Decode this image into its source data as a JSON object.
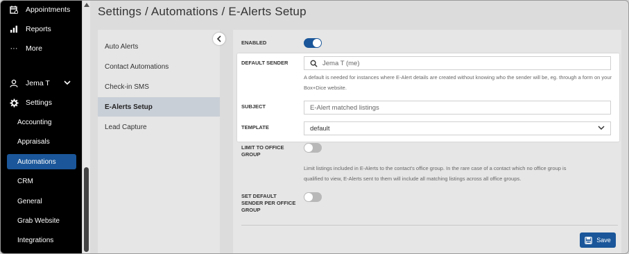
{
  "nav": {
    "items": [
      {
        "label": "Appointments",
        "icon": "calendar-icon"
      },
      {
        "label": "Reports",
        "icon": "bar-chart-icon"
      },
      {
        "label": "More",
        "icon": "ellipsis-icon"
      }
    ],
    "user": {
      "label": "Jema T",
      "icon": "user-icon"
    },
    "settings": {
      "label": "Settings",
      "icon": "gear-icon"
    },
    "sub_items": [
      "Accounting",
      "Appraisals",
      "Automations",
      "CRM",
      "General",
      "Grab Website",
      "Integrations"
    ],
    "active_sub": "Automations"
  },
  "header": {
    "title": "Settings / Automations / E-Alerts Setup"
  },
  "submenu": {
    "items": [
      "Auto Alerts",
      "Contact Automations",
      "Check-in SMS",
      "E-Alerts Setup",
      "Lead Capture"
    ],
    "active": "E-Alerts Setup"
  },
  "form": {
    "enabled": {
      "label": "ENABLED",
      "value": true
    },
    "default_sender": {
      "label": "DEFAULT SENDER",
      "value": "Jema T (me)",
      "help": "A default is needed for instances where E-Alert details are created without knowing who the sender will be, eg. through a form on your Box+Dice website."
    },
    "subject": {
      "label": "SUBJECT",
      "value": "E-Alert matched listings"
    },
    "template": {
      "label": "TEMPLATE",
      "value": "default"
    },
    "limit_to_office_group": {
      "label_line1": "LIMIT TO OFFICE",
      "label_line2": "GROUP",
      "value": false,
      "help_line1": "Limit listings included in E-Alerts to the contact's office group. In the rare case of a contact which no office group is",
      "help_line2": "qualified to view, E-Alerts sent to them will include all matching listings across all office groups."
    },
    "set_default_sender_per_office_group": {
      "label_line1": "SET DEFAULT",
      "label_line2": "SENDER PER OFFICE",
      "label_line3": "GROUP",
      "value": false
    },
    "save_label": "Save"
  },
  "colors": {
    "accent": "#1a5699",
    "nav_bg": "#000000",
    "toggle_off": "#b8b8b8"
  }
}
